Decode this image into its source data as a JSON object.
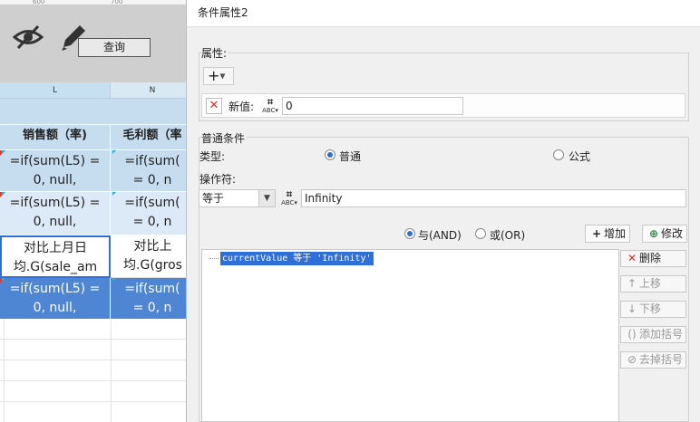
{
  "sheet": {
    "ruler_marks": [
      "600",
      "700"
    ],
    "query_button": "查询",
    "columns": [
      "L",
      "N"
    ],
    "headers": [
      "销售额（率)",
      "毛利额（率"
    ],
    "rows": [
      [
        "=if(sum(L5) =\n0, null,",
        "=if(sum(\n= 0, n"
      ],
      [
        "=if(sum(L5) =\n0, null,",
        "=if(sum(\n= 0, n"
      ],
      [
        "对比上月日\n均.G(sale_am",
        "对比上\n均.G(gros"
      ],
      [
        "=if(sum(L5) =\n0, null,",
        "=if(sum(\n= 0, n"
      ]
    ]
  },
  "dialog": {
    "title": "条件属性2",
    "attr_label": "属性:",
    "plus_label": "+",
    "new_value_label": "新值:",
    "new_value": "0",
    "normal_cond_label": "普通条件",
    "type_label": "类型:",
    "type_options": [
      "普通",
      "公式"
    ],
    "type_selected": "普通",
    "operator_label": "操作符:",
    "operator_value": "等于",
    "operand_value": "Infinity",
    "logic_options": [
      "与(AND)",
      "或(OR)"
    ],
    "logic_selected": "与(AND)",
    "add_button": "增加",
    "modify_button": "修改",
    "condition_items": [
      "currentValue 等于 'Infinity'"
    ],
    "side_buttons": [
      "删除",
      "上移",
      "下移",
      "添加括号",
      "去掉括号"
    ]
  }
}
